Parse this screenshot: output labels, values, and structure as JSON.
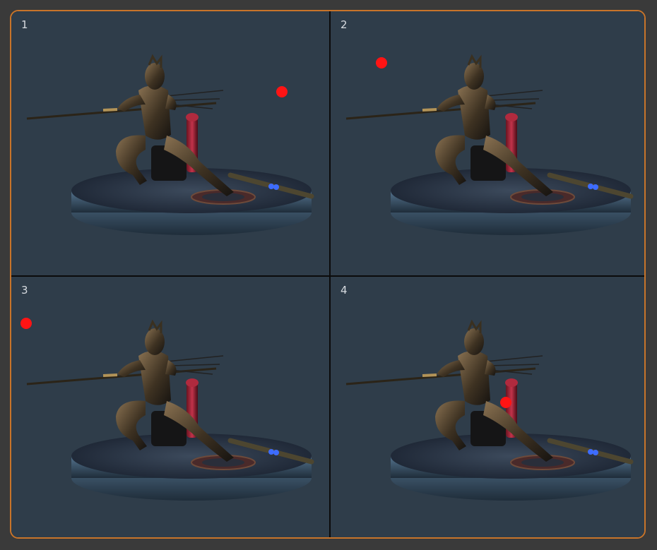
{
  "viewports": [
    {
      "label": "1"
    },
    {
      "label": "2"
    },
    {
      "label": "3"
    },
    {
      "label": "4"
    }
  ],
  "colors": {
    "frame_border": "#c8742a",
    "viewport_bg": "#2f3d4a",
    "light_marker": "#ff1414"
  },
  "icons": {
    "light": "light-position-marker"
  }
}
